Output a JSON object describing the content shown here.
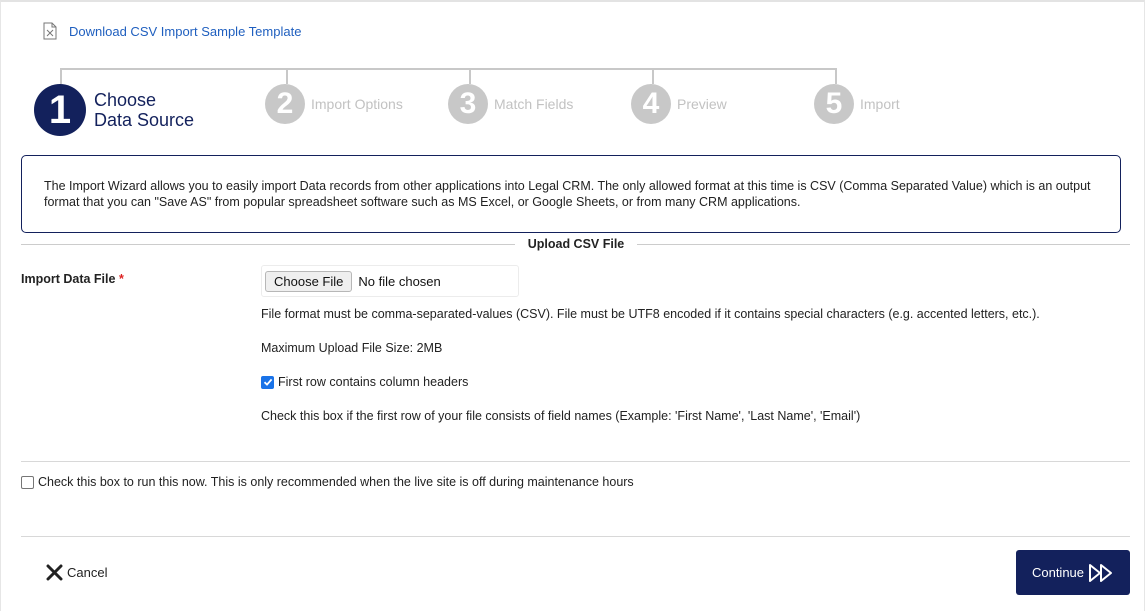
{
  "download": {
    "label": "Download CSV Import Sample Template"
  },
  "wizard": {
    "steps": [
      {
        "number": "1",
        "label_line1": "Choose",
        "label_line2": "Data Source",
        "state": "active"
      },
      {
        "number": "2",
        "label": "Import Options",
        "state": "inactive"
      },
      {
        "number": "3",
        "label": "Match Fields",
        "state": "inactive"
      },
      {
        "number": "4",
        "label": "Preview",
        "state": "inactive"
      },
      {
        "number": "5",
        "label": "Import",
        "state": "inactive"
      }
    ]
  },
  "info": {
    "text": "The Import Wizard allows you to easily import Data records from other applications into Legal CRM. The only allowed format at this time is CSV (Comma Separated Value) which is an output format that you can \"Save AS\" from popular spreadsheet software such as MS Excel, or Google Sheets, or from many CRM applications."
  },
  "section": {
    "title": "Upload CSV File"
  },
  "import_field": {
    "label": "Import Data File",
    "required_mark": "*",
    "choose_button": "Choose File",
    "no_file_text": "No file chosen",
    "format_help": "File format must be comma-separated-values (CSV). File must be UTF8 encoded if it contains special characters (e.g. accented letters, etc.).",
    "max_size": "Maximum Upload File Size: 2MB",
    "headers_checkbox": {
      "label": "First row contains column headers",
      "checked": true
    },
    "headers_help": "Check this box if the first row of your file consists of field names (Example: 'First Name', 'Last Name', 'Email')"
  },
  "run_now": {
    "label": "Check this box to run this now. This is only recommended when the live site is off during maintenance hours",
    "checked": false
  },
  "footer": {
    "cancel_label": "Cancel",
    "continue_label": "Continue"
  },
  "colors": {
    "primary": "#13215c",
    "inactive_step": "#c8c8c8",
    "link": "#1f5fbf",
    "checkbox": "#1a73e8"
  }
}
